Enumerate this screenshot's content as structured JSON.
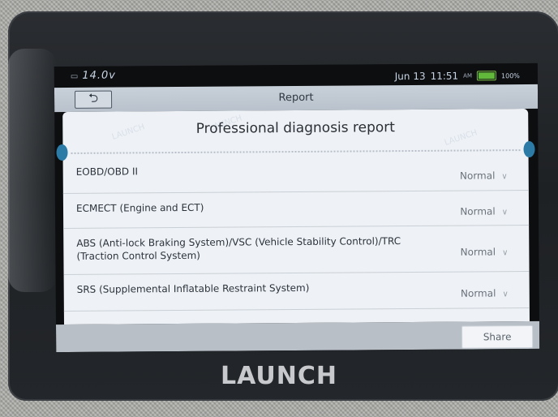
{
  "status_bar": {
    "voltage": "14.0v",
    "date": "Jun 13",
    "time": "11:51",
    "ampm": "AM",
    "battery": "100%"
  },
  "header": {
    "back_symbol": "⮌",
    "title": "Report"
  },
  "report": {
    "title": "Professional diagnosis report",
    "rows": [
      {
        "name": "EOBD/OBD II",
        "status": "Normal"
      },
      {
        "name": "ECMECT (Engine and ECT)",
        "status": "Normal"
      },
      {
        "name": "ABS (Anti-lock Braking System)/VSC (Vehicle Stability Control)/TRC (Traction Control System)",
        "status": "Normal"
      },
      {
        "name": "SRS (Supplemental Inflatable Restraint System)",
        "status": "Normal"
      }
    ]
  },
  "footer": {
    "share_label": "Share"
  },
  "device": {
    "brand": "LAUNCH",
    "watermark": "LAUNCH"
  },
  "icons": {
    "chevron": "chevron-down-icon",
    "back": "back-arrow-icon",
    "battery": "battery-icon"
  }
}
